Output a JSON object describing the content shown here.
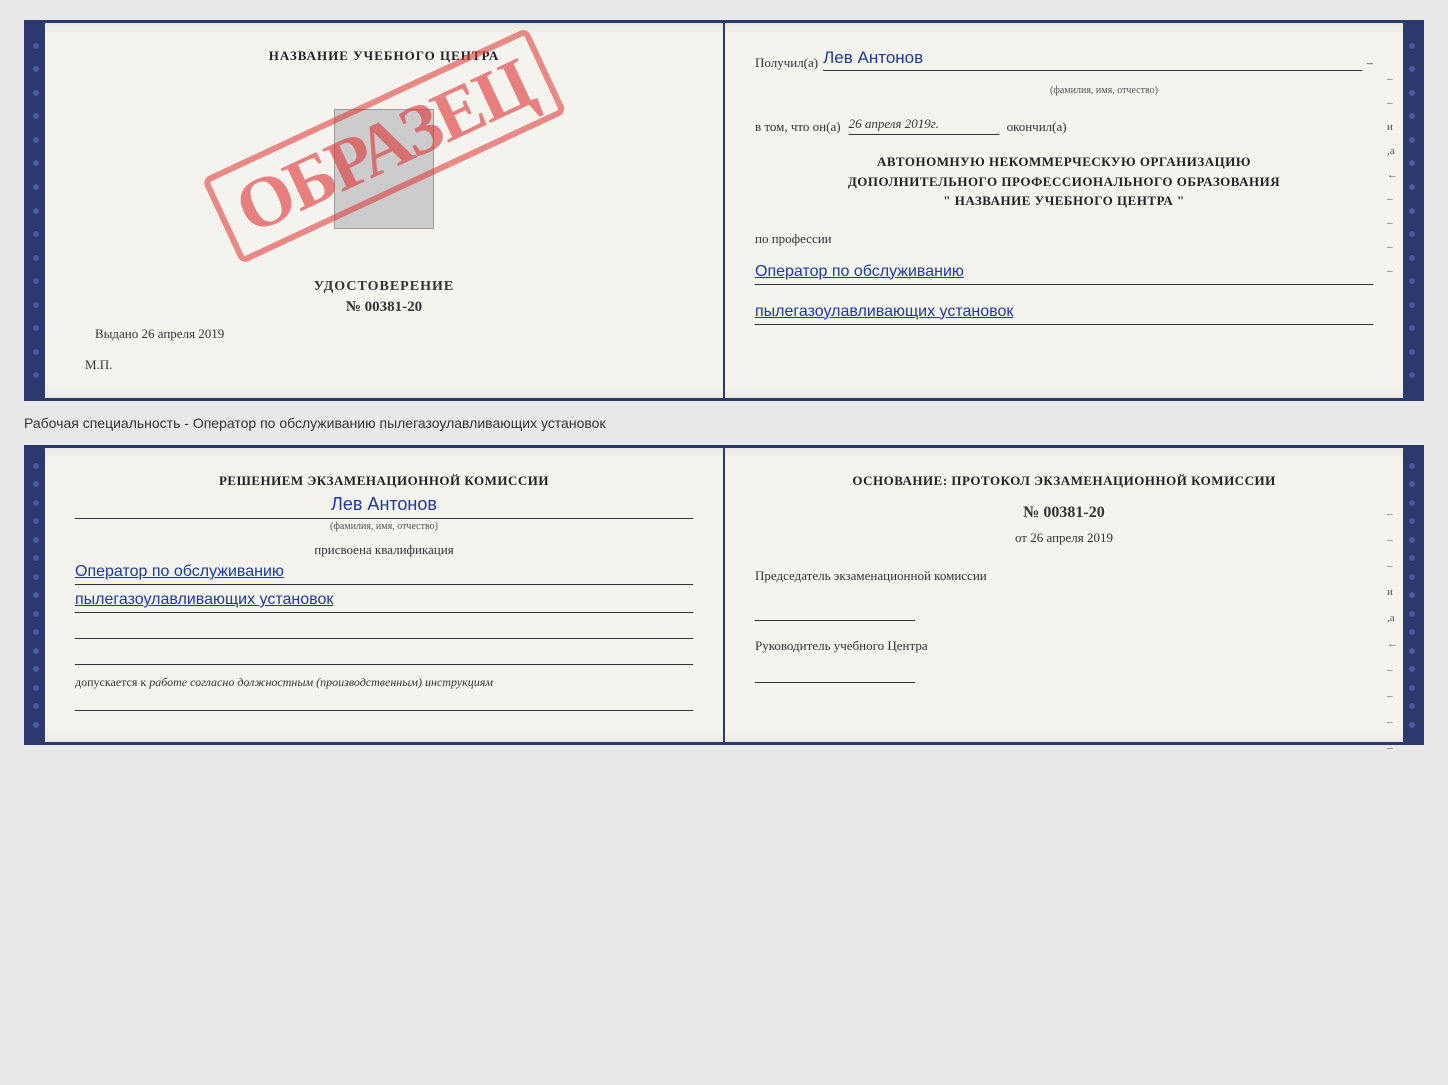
{
  "top_doc": {
    "left": {
      "training_center": "НАЗВАНИЕ УЧЕБНОГО ЦЕНТРА",
      "obrazets": "ОБРАЗЕЦ",
      "udostoverenie_label": "УДОСТОВЕРЕНИЕ",
      "udostoverenie_number": "№ 00381-20",
      "vydano_label": "Выдано",
      "vydano_date": "26 апреля 2019",
      "mp_label": "М.П."
    },
    "right": {
      "poluchil_label": "Получил(а)",
      "poluchil_name": "Лев Антонов",
      "fio_subtitle": "(фамилия, имя, отчество)",
      "dash": "–",
      "vtom_label": "в том, что он(а)",
      "vtom_date": "26 апреля 2019г.",
      "okoncil_label": "окончил(а)",
      "org_line1": "АВТОНОМНУЮ НЕКОММЕРЧЕСКУЮ ОРГАНИЗАЦИЮ",
      "org_line2": "ДОПОЛНИТЕЛЬНОГО ПРОФЕССИОНАЛЬНОГО ОБРАЗОВАНИЯ",
      "org_name": "\" НАЗВАНИЕ УЧЕБНОГО ЦЕНТРА \"",
      "side_mark_i": "и",
      "side_mark_a": ",а",
      "side_mark_arrow": "←",
      "po_professii_label": "по профессии",
      "profession1": "Оператор по обслуживанию",
      "profession2": "пылегазоулавливающих установок"
    }
  },
  "caption": "Рабочая специальность - Оператор по обслуживанию пылегазоулавливающих установок",
  "bottom_doc": {
    "left": {
      "resheniem_label": "Решением экзаменационной комиссии",
      "person_name": "Лев Антонов",
      "fio_subtitle": "(фамилия, имя, отчество)",
      "prisvoena_label": "присвоена квалификация",
      "qual1": "Оператор по обслуживанию",
      "qual2": "пылегазоулавливающих установок",
      "dopuskaetsya_prefix": "допускается к",
      "dopuskaetsya_italic": "работе согласно должностным (производственным) инструкциям"
    },
    "right": {
      "osnovanie_label": "Основание: протокол экзаменационной комиссии",
      "number": "№  00381-20",
      "ot_label": "от",
      "ot_date": "26 апреля 2019",
      "predsedatel_label": "Председатель экзаменационной комиссии",
      "rukovoditel_label": "Руководитель учебного Центра",
      "side_mark_i": "и",
      "side_mark_a": ",а",
      "side_mark_arrow": "←"
    }
  }
}
